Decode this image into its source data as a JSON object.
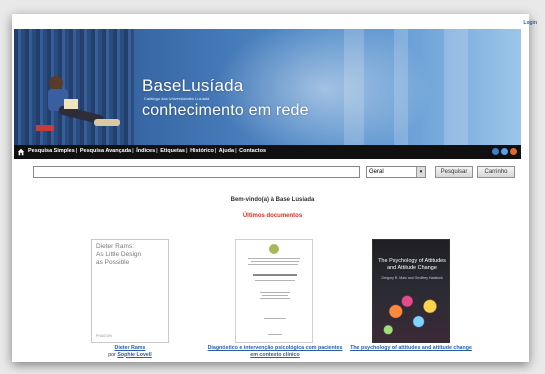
{
  "header": {
    "login_label": "Login"
  },
  "banner": {
    "title": "BaseLusíada",
    "subtitle": "Catálogo das Universidades Lusíada",
    "tagline": "conhecimento em rede"
  },
  "nav": {
    "items": [
      {
        "label": "Pesquisa Simples"
      },
      {
        "label": "Pesquisa Avançada"
      },
      {
        "label": "Índices"
      },
      {
        "label": "Etiquetas"
      },
      {
        "label": "Histórico"
      },
      {
        "label": "Ajuda"
      },
      {
        "label": "Contactos"
      }
    ]
  },
  "search": {
    "value": "",
    "scope": "Geral",
    "search_button": "Pesquisar",
    "cart_button": "Carrinho"
  },
  "main": {
    "welcome": "Bem-vindo(a) à Base Lusíada",
    "recent_heading": "Últimos documentos"
  },
  "documents": [
    {
      "cover_text": "Dieter Rams:\nAs Little Design\nas Possible",
      "cover_publisher": "PHAIDON",
      "title": "Dieter Rams",
      "by_label": "por",
      "author": "Sophie Lovell"
    },
    {
      "title": "Diagnóstico e intervenção psicológica com pacientes em contexto clínico"
    },
    {
      "cover_text": "The Psychology of Attitudes and Attitude Change",
      "cover_authors": "Gregory R. Maio and Geoffrey Haddock",
      "title": "The psychology of attitudes and attitude change"
    }
  ],
  "colors": {
    "accent_link": "#2a5fa8",
    "accent_red": "#e0302a",
    "navbar": "#101010"
  }
}
